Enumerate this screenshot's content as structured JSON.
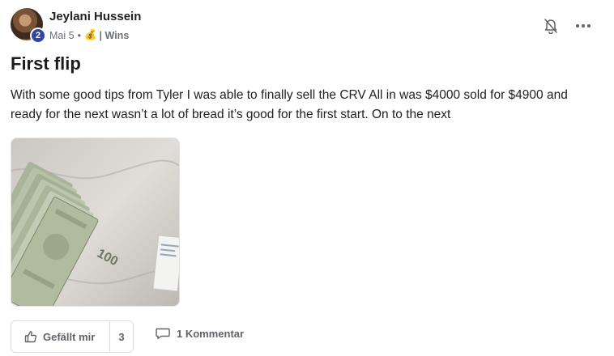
{
  "post": {
    "author": "Jeylani Hussein",
    "level": "2",
    "date": "Mai 5",
    "separator": "•",
    "category_emoji": "💰",
    "category": "| Wins",
    "title": "First flip",
    "body": "With some good tips from Tyler I was able to finally sell the CRV All in was $4000 sold for $4900 and ready for the next wasn’t a lot of bread it’s good for the first start. On to the next",
    "image_banknote_text": "100"
  },
  "actions": {
    "like_label": "Gefällt mir",
    "like_count": "3",
    "comment_label": "1 Kommentar"
  },
  "colors": {
    "level_badge": "#2f46a5",
    "text": "#202124",
    "muted": "#6b6f76",
    "border": "#d9dadc"
  },
  "icons": {
    "bell": "bell-off-icon",
    "more": "more-horizontal-icon",
    "like": "thumbs-up-icon",
    "comment": "comment-bubble-icon"
  }
}
